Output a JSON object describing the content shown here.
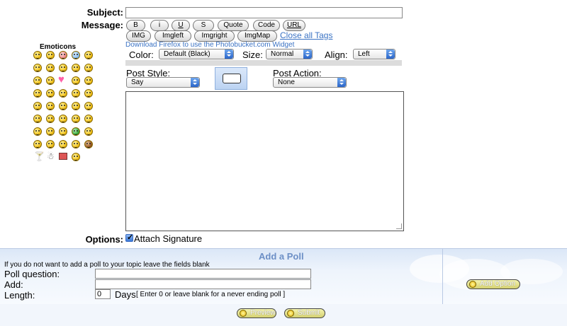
{
  "form": {
    "subject_label": "Subject:",
    "subject_value": "",
    "message_label": "Message:",
    "tags_row1": [
      "B",
      "i",
      "U",
      "S",
      "Quote",
      "Code",
      "URL"
    ],
    "tags_row2": [
      "IMG",
      "Imgleft",
      "Imgright",
      "ImgMap"
    ],
    "close_tags": "Close all Tags",
    "download_link": "Download Firefox to use the Photobucket.com Widget",
    "color_label": "Color:",
    "color_value": "Default (Black)",
    "size_label": "Size:",
    "size_value": "Normal",
    "align_label": "Align:",
    "align_value": "Left",
    "post_style_label": "Post Style:",
    "post_style_value": "Say",
    "post_action_label": "Post Action:",
    "post_action_value": "None",
    "options_label": "Options:",
    "attach_signature": "Attach Signature",
    "attach_checked": true
  },
  "emoticons": {
    "title": "Emoticons",
    "rows": [
      5,
      5,
      5,
      5,
      5,
      5,
      5,
      5,
      5,
      4
    ]
  },
  "poll": {
    "title": "Add a Poll",
    "hint": "If you do not want to add a poll to your topic leave the fields blank",
    "question_label": "Poll question:",
    "add_label": "Add:",
    "length_label": "Length:",
    "length_value": "0",
    "days_label": "Days",
    "days_note": "[ Enter 0 or leave blank for a never ending poll ]",
    "add_option": "Add Option"
  },
  "actions": {
    "preview": "Preview",
    "submit": "Submit"
  },
  "colors": {
    "link": "#3b73c4",
    "poll_bg": "#e7eef9"
  }
}
